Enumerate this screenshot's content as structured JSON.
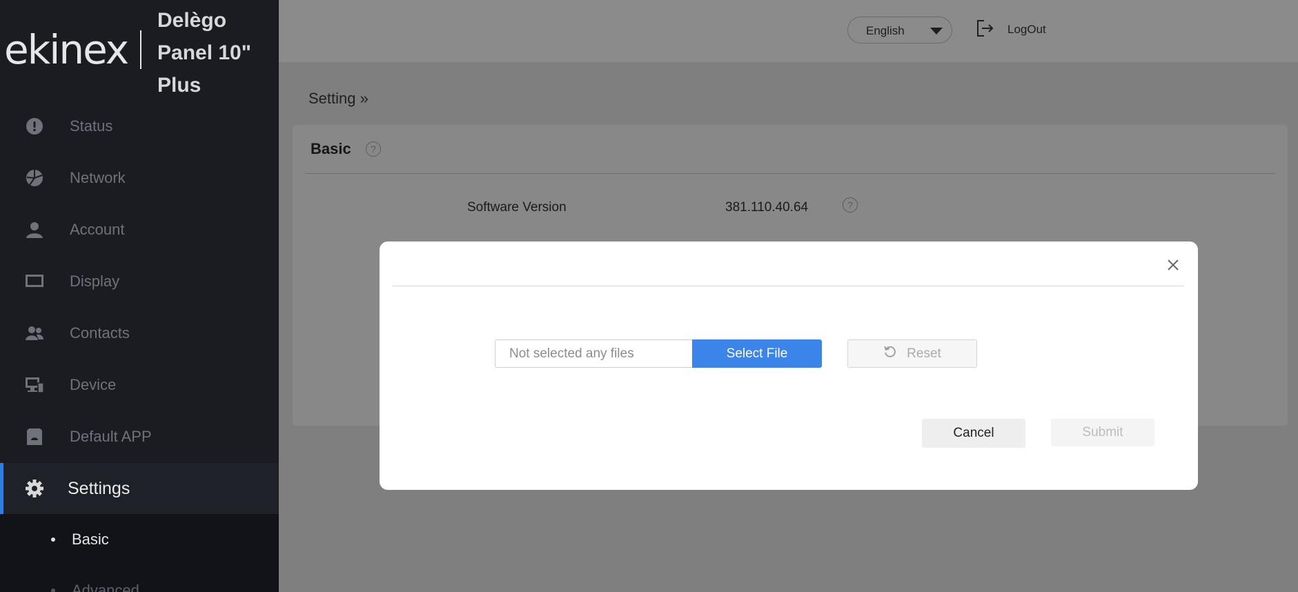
{
  "brand": {
    "logo": "ekinex",
    "product_line1": "Delègo",
    "product_line2": "Panel 10\"",
    "product_line3": "Plus"
  },
  "sidebar": {
    "items": [
      {
        "label": "Status",
        "icon": "exclamation-circle-icon"
      },
      {
        "label": "Network",
        "icon": "network-icon"
      },
      {
        "label": "Account",
        "icon": "user-icon"
      },
      {
        "label": "Display",
        "icon": "monitor-icon"
      },
      {
        "label": "Contacts",
        "icon": "contacts-icon"
      },
      {
        "label": "Device",
        "icon": "device-icon"
      },
      {
        "label": "Default APP",
        "icon": "app-icon"
      },
      {
        "label": "Settings",
        "icon": "gear-icon",
        "active": true
      }
    ],
    "subitems": [
      {
        "label": "Basic",
        "active": true
      },
      {
        "label": "Advanced",
        "active": false
      }
    ]
  },
  "header": {
    "language": "English",
    "logout_label": "LogOut"
  },
  "main": {
    "breadcrumb": "Setting »",
    "panel_title": "Basic",
    "rows": [
      {
        "label": "Software Version",
        "value": "381.110.40.64"
      }
    ]
  },
  "modal": {
    "file_placeholder": "Not selected any files",
    "select_file_label": "Select File",
    "reset_label": "Reset",
    "cancel_label": "Cancel",
    "submit_label": "Submit"
  },
  "colors": {
    "accent": "#3b84ea",
    "sidebar_bg": "#1a1c22",
    "overlay": "#7f7f7f"
  }
}
